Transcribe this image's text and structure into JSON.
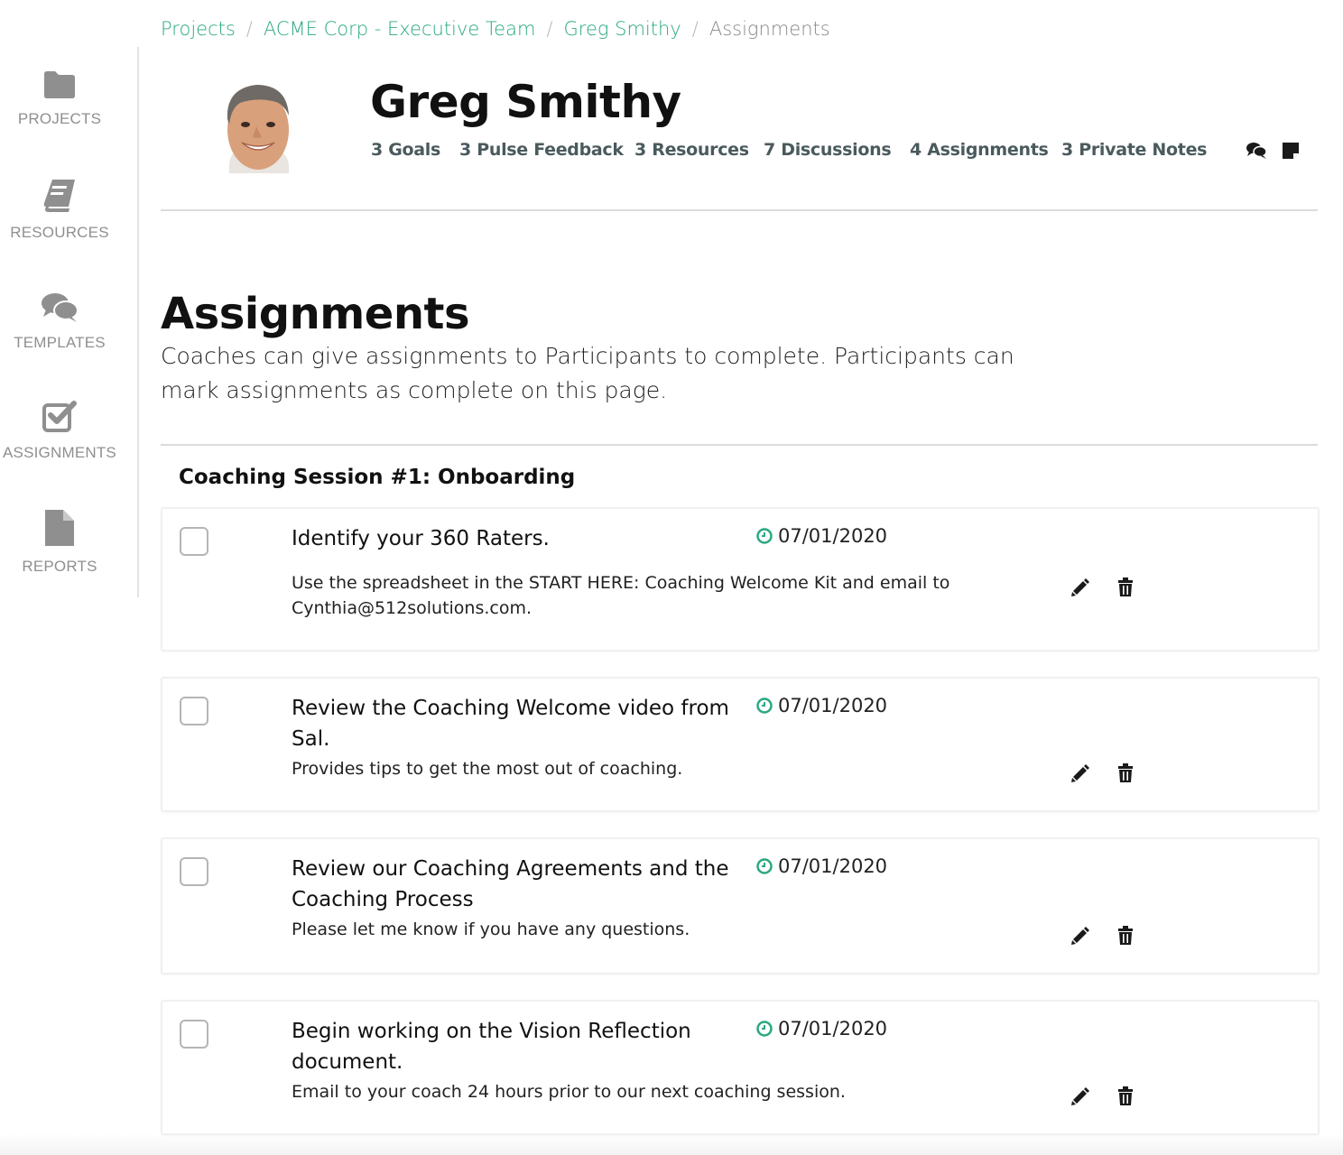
{
  "colors": {
    "accent": "#2aa882",
    "muted": "#8f8f8f",
    "stat": "#4a5a5d"
  },
  "sidebar": {
    "items": [
      {
        "label": "PROJECTS",
        "icon": "folder-icon"
      },
      {
        "label": "RESOURCES",
        "icon": "book-icon"
      },
      {
        "label": "TEMPLATES",
        "icon": "chat-bubbles-icon"
      },
      {
        "label": "ASSIGNMENTS",
        "icon": "checked-box-icon"
      },
      {
        "label": "REPORTS",
        "icon": "document-icon"
      }
    ]
  },
  "breadcrumb": {
    "items": [
      "Projects",
      "ACME Corp - Executive Team",
      "Greg Smithy"
    ],
    "current": "Assignments",
    "separator": "/"
  },
  "profile": {
    "name": "Greg Smithy",
    "stats": [
      "3 Goals",
      "3 Pulse Feedback",
      "3 Resources",
      "7 Discussions",
      "4 Assignments",
      "3 Private Notes"
    ],
    "icons": [
      "chat-icon",
      "sticky-note-icon"
    ]
  },
  "page": {
    "title": "Assignments",
    "description": "Coaches can give assignments to Participants to complete. Participants can mark assignments as complete on this page."
  },
  "section": {
    "title": "Coaching Session #1: Onboarding",
    "assignments": [
      {
        "title": "Identify your 360 Raters.",
        "date": "07/01/2020",
        "description": "Use the spreadsheet in the START HERE: Coaching Welcome Kit and email to Cynthia@512solutions.com.",
        "completed": false
      },
      {
        "title": "Review the Coaching Welcome video from Sal.",
        "date": "07/01/2020",
        "description": "Provides tips to get the most out of coaching.",
        "completed": false
      },
      {
        "title": "Review our Coaching Agreements and the Coaching Process",
        "date": "07/01/2020",
        "description": "Please let me know if you have any questions.",
        "completed": false
      },
      {
        "title": "Begin working on the Vision Reflection document.",
        "date": "07/01/2020",
        "description": "Email to your coach 24 hours prior to our next coaching session.",
        "completed": false
      }
    ]
  }
}
